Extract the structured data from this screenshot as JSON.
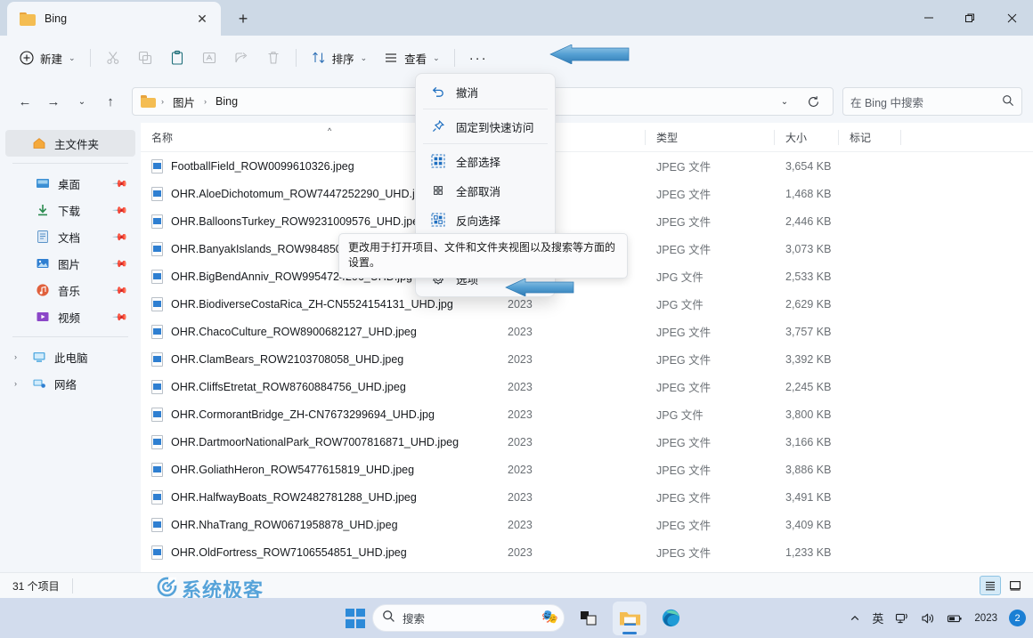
{
  "window": {
    "tab_title": "Bing",
    "tab_close_icon": "close-icon",
    "new_tab_icon": "plus-icon",
    "minimize_icon": "minimize-icon",
    "maximize_icon": "restore-icon",
    "close_icon": "close-icon"
  },
  "toolbar": {
    "new_label": "新建",
    "new_icon": "plus-circle-icon",
    "cut_icon": "scissors-icon",
    "copy_icon": "copy-icon",
    "paste_icon": "paste-icon",
    "rename_icon": "rename-icon",
    "share_icon": "share-icon",
    "delete_icon": "trash-icon",
    "sort_label": "排序",
    "sort_icon": "sort-icon",
    "view_label": "查看",
    "view_icon": "view-list-icon",
    "more_label": "···",
    "more_icon": "ellipsis-icon"
  },
  "address": {
    "back_icon": "arrow-left-icon",
    "forward_icon": "arrow-right-icon",
    "recent_icon": "chevron-down-icon",
    "up_icon": "arrow-up-icon",
    "folder_icon": "folder-icon",
    "crumbs": [
      "图片",
      "Bing"
    ],
    "separator": "›",
    "dropdown_icon": "chevron-down-icon",
    "refresh_icon": "refresh-icon",
    "search_placeholder": "在 Bing 中搜索",
    "search_icon": "search-icon"
  },
  "sidebar": {
    "home": {
      "label": "主文件夹",
      "icon": "home-icon",
      "selected": true
    },
    "quick": [
      {
        "label": "桌面",
        "icon": "desktop-icon",
        "pinned": true
      },
      {
        "label": "下载",
        "icon": "download-icon",
        "pinned": true
      },
      {
        "label": "文档",
        "icon": "documents-icon",
        "pinned": true
      },
      {
        "label": "图片",
        "icon": "pictures-icon",
        "pinned": true
      },
      {
        "label": "音乐",
        "icon": "music-icon",
        "pinned": true
      },
      {
        "label": "视频",
        "icon": "videos-icon",
        "pinned": true
      }
    ],
    "roots": [
      {
        "label": "此电脑",
        "icon": "this-pc-icon",
        "expander": "›"
      },
      {
        "label": "网络",
        "icon": "network-icon",
        "expander": "›"
      }
    ],
    "pin_icon": "pin-icon"
  },
  "columns": {
    "name": "名称",
    "date": "",
    "type": "类型",
    "size": "大小",
    "tags": "标记",
    "sort_indicator": "^"
  },
  "files": [
    {
      "name": "FootballField_ROW0099610326.jpeg",
      "date": "",
      "type": "JPEG 文件",
      "size": "3,654 KB",
      "tags": ""
    },
    {
      "name": "OHR.AloeDichotomum_ROW7447252290_UHD.jpeg",
      "date": "",
      "type": "JPEG 文件",
      "size": "1,468 KB",
      "tags": ""
    },
    {
      "name": "OHR.BalloonsTurkey_ROW9231009576_UHD.jpeg",
      "date": "",
      "type": "JPEG 文件",
      "size": "2,446 KB",
      "tags": ""
    },
    {
      "name": "OHR.BanyakIslands_ROW9848502865_UHD.jpeg",
      "date": "",
      "type": "JPEG 文件",
      "size": "3,073 KB",
      "tags": ""
    },
    {
      "name": "OHR.BigBendAnniv_ROW9954724206_UHD.jpg",
      "date": "",
      "type": "JPG 文件",
      "size": "2,533 KB",
      "tags": ""
    },
    {
      "name": "OHR.BiodiverseCostaRica_ZH-CN5524154131_UHD.jpg",
      "date": "2023",
      "type": "JPG 文件",
      "size": "2,629 KB",
      "tags": ""
    },
    {
      "name": "OHR.ChacoCulture_ROW8900682127_UHD.jpeg",
      "date": "2023",
      "type": "JPEG 文件",
      "size": "3,757 KB",
      "tags": ""
    },
    {
      "name": "OHR.ClamBears_ROW2103708058_UHD.jpeg",
      "date": "2023",
      "type": "JPEG 文件",
      "size": "3,392 KB",
      "tags": ""
    },
    {
      "name": "OHR.CliffsEtretat_ROW8760884756_UHD.jpeg",
      "date": "2023",
      "type": "JPEG 文件",
      "size": "2,245 KB",
      "tags": ""
    },
    {
      "name": "OHR.CormorantBridge_ZH-CN7673299694_UHD.jpg",
      "date": "2023",
      "type": "JPG 文件",
      "size": "3,800 KB",
      "tags": ""
    },
    {
      "name": "OHR.DartmoorNationalPark_ROW7007816871_UHD.jpeg",
      "date": "2023",
      "type": "JPEG 文件",
      "size": "3,166 KB",
      "tags": ""
    },
    {
      "name": "OHR.GoliathHeron_ROW5477615819_UHD.jpeg",
      "date": "2023",
      "type": "JPEG 文件",
      "size": "3,886 KB",
      "tags": ""
    },
    {
      "name": "OHR.HalfwayBoats_ROW2482781288_UHD.jpeg",
      "date": "2023",
      "type": "JPEG 文件",
      "size": "3,491 KB",
      "tags": ""
    },
    {
      "name": "OHR.NhaTrang_ROW0671958878_UHD.jpeg",
      "date": "2023",
      "type": "JPEG 文件",
      "size": "3,409 KB",
      "tags": ""
    },
    {
      "name": "OHR.OldFortress_ROW7106554851_UHD.jpeg",
      "date": "2023",
      "type": "JPEG 文件",
      "size": "1,233 KB",
      "tags": ""
    }
  ],
  "context_menu": {
    "items": [
      {
        "label": "撤消",
        "icon": "undo-icon"
      },
      {
        "label": "固定到快速访问",
        "icon": "pin-icon"
      },
      {
        "label": "全部选择",
        "icon": "select-all-icon"
      },
      {
        "label": "全部取消",
        "icon": "select-none-icon"
      },
      {
        "label": "反向选择",
        "icon": "invert-selection-icon"
      },
      {
        "label": "选项",
        "icon": "gear-icon"
      }
    ]
  },
  "tooltip": {
    "text": "更改用于打开项目、文件和文件夹视图以及搜索等方面的设置。"
  },
  "status": {
    "item_count": "31 个项目",
    "details_view_icon": "details-view-icon",
    "large_icons_view_icon": "large-icons-view-icon"
  },
  "watermark": {
    "text": "系统极客",
    "logo_icon": "circle-logo-icon"
  },
  "taskbar": {
    "start_icon": "windows-start-icon",
    "search_placeholder": "搜索",
    "search_icon": "search-icon",
    "pinned": [
      {
        "icon": "widget-icon",
        "name": "widgets"
      },
      {
        "icon": "file-explorer-icon",
        "name": "file-explorer",
        "active": true
      },
      {
        "icon": "edge-icon",
        "name": "microsoft-edge"
      }
    ],
    "tray": {
      "overflow": "⌃",
      "ime": "英",
      "network_icon": "network-icon",
      "volume_icon": "volume-icon",
      "battery_icon": "battery-icon",
      "year": "2023",
      "notification_count": "2"
    }
  },
  "colors": {
    "accent": "#2d7fd0",
    "titlebar": "#cdd9e6",
    "toolbar": "#f3f6fa",
    "arrow": "#4e9fd8"
  }
}
